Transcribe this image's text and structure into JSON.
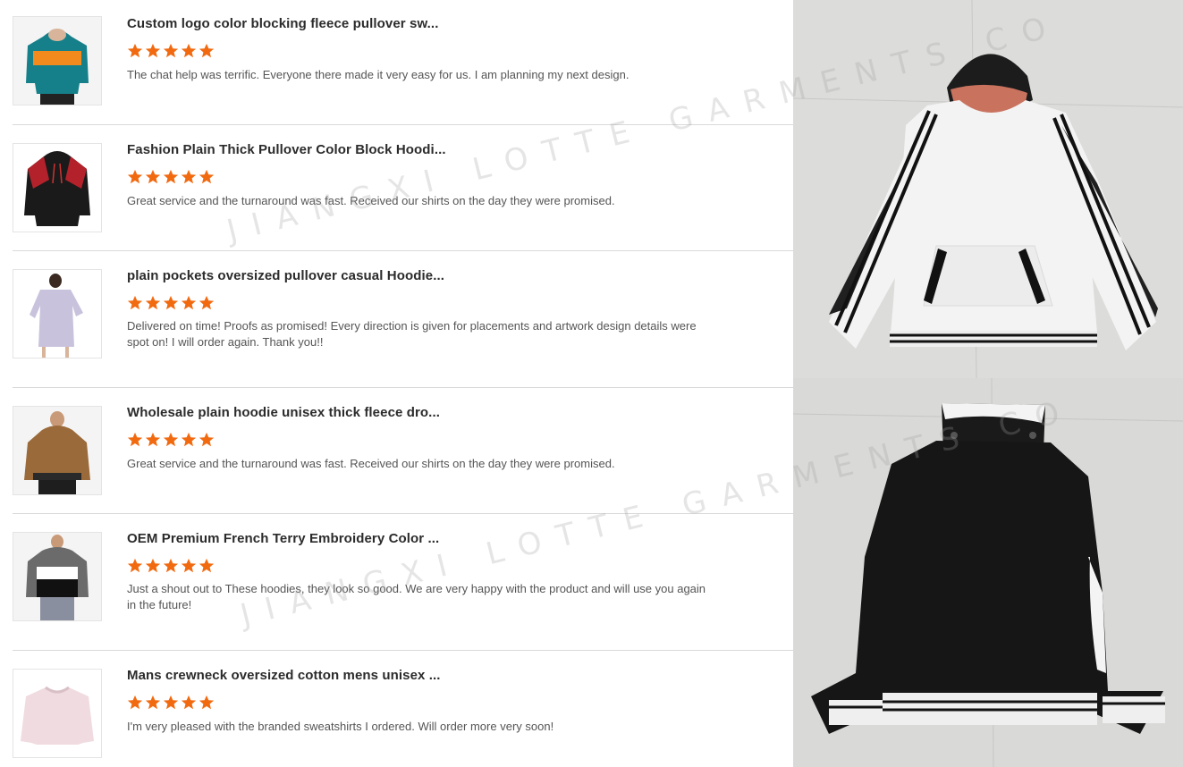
{
  "colors": {
    "star": "#f26a10",
    "title": "#2b2b2b",
    "text": "#555555"
  },
  "star_icon": "star-icon",
  "watermark": "JIANGXI LOTTE GARMENTS CO",
  "reviews": [
    {
      "title": "Custom logo color blocking fleece pullover sw...",
      "rating": 5,
      "text": "The chat help was terrific. Everyone there made it very easy for us. I am planning my next design."
    },
    {
      "title": "Fashion Plain Thick Pullover Color Block Hoodi...",
      "rating": 5,
      "text": "Great service and the turnaround was fast. Received our shirts on the day they were promised."
    },
    {
      "title": "plain pockets oversized pullover casual Hoodie...",
      "rating": 5,
      "text": "Delivered on time! Proofs as promised! Every direction is given for placements and artwork design details were spot on! I will order again. Thank you!!"
    },
    {
      "title": "Wholesale plain hoodie unisex thick fleece dro...",
      "rating": 5,
      "text": "Great service and the turnaround was fast. Received our shirts on the day they were promised."
    },
    {
      "title": "OEM Premium French Terry Embroidery Color ...",
      "rating": 5,
      "text": "Just a shout out to These hoodies, they look so good. We are very happy with the product and will use you again in the future!"
    },
    {
      "title": "Mans crewneck oversized cotton mens unisex ...",
      "rating": 5,
      "text": "I'm very pleased with the branded sweatshirts I ordered. Will order more very soon!"
    }
  ]
}
